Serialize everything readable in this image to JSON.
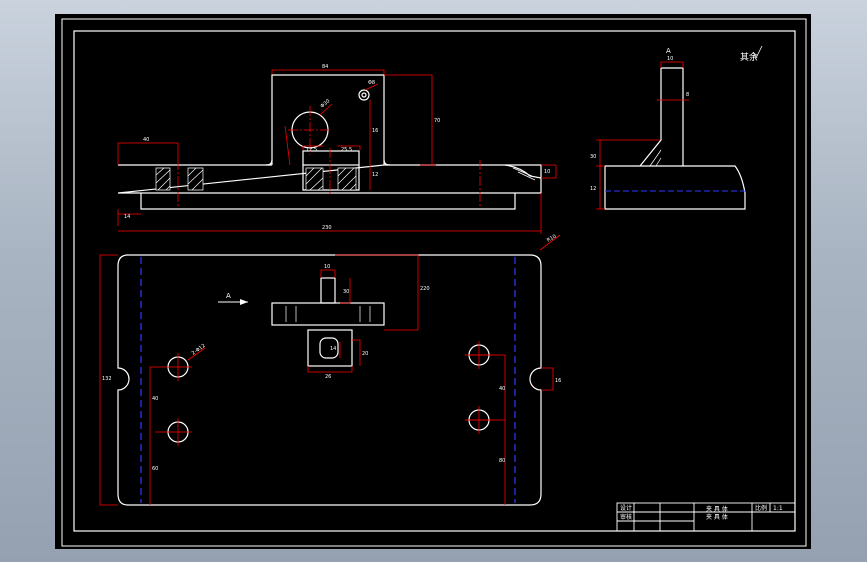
{
  "drawing": {
    "view_label_a_top": "A",
    "view_label_a_plan": "A",
    "view_label_side": "A",
    "roughness_note": "其余",
    "dimensions": {
      "top_width": "84",
      "left_step": "40",
      "bore_dia": "Φ30",
      "small_hole_dia": "Φ8",
      "height_right": "70",
      "slot_left": "12.5",
      "slot_right": "25.5",
      "slot_height": "16",
      "base_thk": "12",
      "left_bottom": "14",
      "overall_length": "230",
      "right_step": "10",
      "plan_corner_r": "R10",
      "plan_height": "132",
      "plan_width": "220",
      "hole_dia_plan": "2-Φ12",
      "rib_width": "10",
      "rib_height": "30",
      "slot_w": "26",
      "slot_h": "20",
      "slot_inner": "14",
      "left_hole_y1": "40",
      "left_hole_y2": "60",
      "right_hole_y1": "40",
      "right_hole_y2": "80",
      "ear_w": "16",
      "side_top": "10",
      "side_h1": "30",
      "side_h2": "8",
      "side_h3": "12"
    }
  },
  "title_block": {
    "row1_label": "设计",
    "row2_label": "审核",
    "part_name_1": "夹 具 体",
    "part_name_2": "夹 具 体",
    "scale_label": "比例",
    "scale_value": "1:1"
  }
}
